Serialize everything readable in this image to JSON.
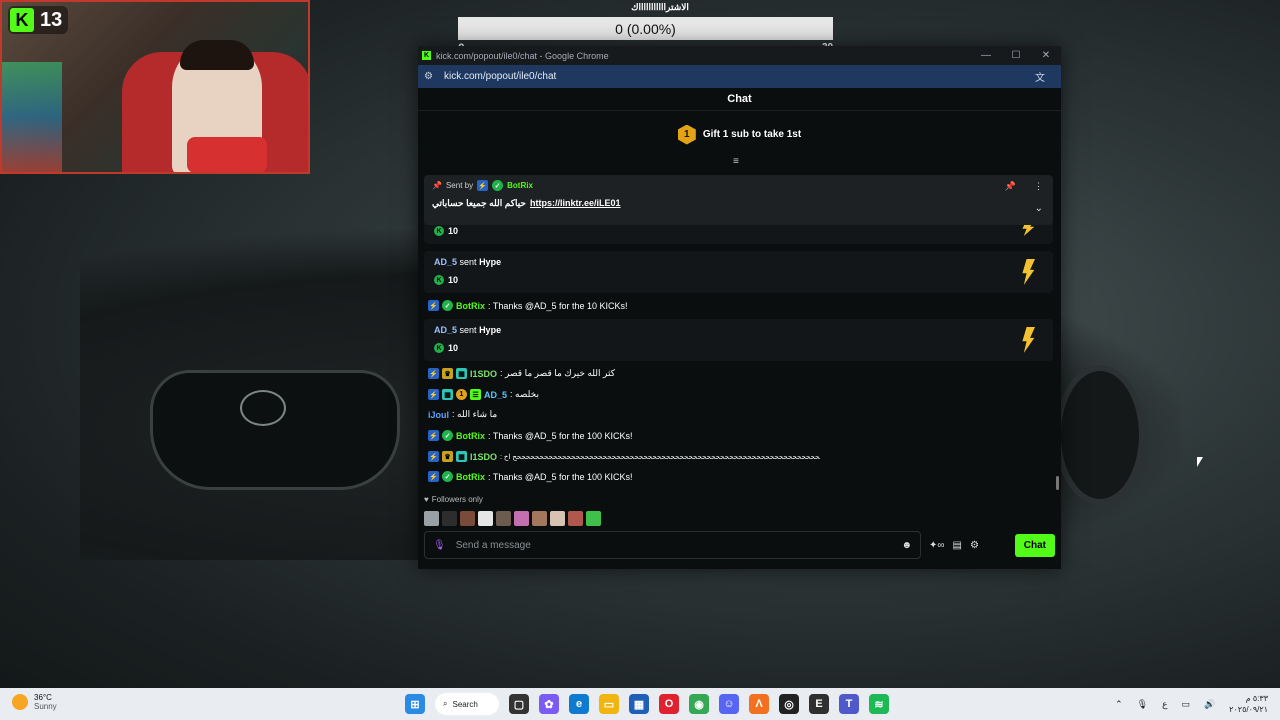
{
  "webcam": {
    "brand": "K",
    "count": "13"
  },
  "goal": {
    "title": "الاشتراااااااااااك",
    "progress_text": "0 (0.00%)",
    "min": "0",
    "max": "30",
    "fraction": 0
  },
  "window": {
    "title": "kick.com/popout/ile0/chat - Google Chrome",
    "url": "kick.com/popout/ile0/chat"
  },
  "chat": {
    "header": "Chat",
    "gift": {
      "rank": "1",
      "text": "Gift 1 sub to take 1st"
    },
    "pinned": {
      "sent_by_label": "Sent by",
      "user": "BotRix",
      "text": "حياكم الله جميعا حساباتي",
      "link": "https://linktr.ee/iLE01"
    },
    "partial_amount": "10",
    "hype": [
      {
        "user": "AD_5",
        "verb": "sent",
        "item": "Hype",
        "amount": "10"
      },
      {
        "user": "AD_5",
        "verb": "sent",
        "item": "Hype",
        "amount": "10"
      }
    ],
    "messages": [
      {
        "user": "BotRix",
        "text": ": Thanks @AD_5 for the 10 KICKs!"
      },
      {
        "user": "I1SDO",
        "text": ": كثر الله خيرك ما قصر ما قصر"
      },
      {
        "user": "AD_5",
        "text": ": بخلصه"
      },
      {
        "user": "iJoul",
        "text": ": ما شاء الله"
      },
      {
        "user": "BotRix",
        "text": ": Thanks @AD_5 for the 100 KICKs!"
      },
      {
        "user": "I1SDO",
        "text": ": ححححححححححححححححححححححححححححححححححححححححححححححححححححححححححححححححححححححححح اخ"
      },
      {
        "user": "BotRix",
        "text": ": Thanks @AD_5 for the 100 KICKs!"
      }
    ],
    "followers_only": "Followers only",
    "input_placeholder": "Send a message",
    "send_label": "Chat",
    "accent": "#53fc18"
  },
  "taskbar": {
    "temp": "36°C",
    "condition": "Sunny",
    "search_label": "Search",
    "time": "٥:٣٣ م",
    "date": "٢٠٢٥/٠٩/٢١",
    "lang": "ع"
  }
}
